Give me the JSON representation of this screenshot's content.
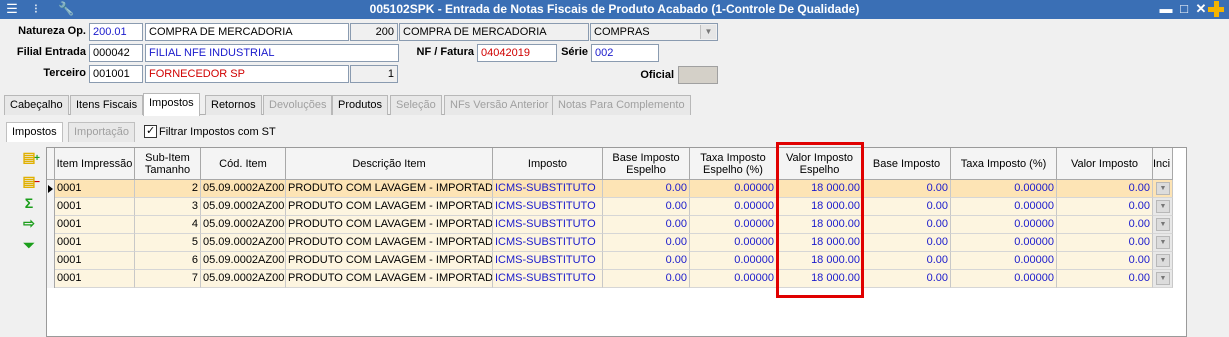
{
  "window": {
    "title": "005102SPK - Entrada de Notas Fiscais de Produto Acabado (1-Controle De Qualidade)",
    "min_label": "▬",
    "max_label": "□",
    "close_label": "✕"
  },
  "header": {
    "natureza_label": "Natureza Op.",
    "natureza_code": "200.01",
    "natureza_desc": "COMPRA DE MERCADORIA",
    "natureza_num": "200",
    "natureza_desc2": "COMPRA DE MERCADORIA",
    "natureza_combo": "COMPRAS",
    "filial_label": "Filial Entrada",
    "filial_code": "000042",
    "filial_desc": "FILIAL NFE INDUSTRIAL",
    "nf_label": "NF / Fatura",
    "nf_value": "04042019",
    "serie_label": "Série",
    "serie_value": "002",
    "terceiro_label": "Terceiro",
    "terceiro_code": "001001",
    "terceiro_desc": "FORNECEDOR SP",
    "terceiro_num": "1",
    "oficial_label": "Oficial",
    "oficial_value": ""
  },
  "tabs": [
    {
      "label": "Cabeçalho",
      "state": "normal"
    },
    {
      "label": "Itens Fiscais",
      "state": "normal"
    },
    {
      "label": "Impostos",
      "state": "active"
    },
    {
      "label": "Retornos",
      "state": "normal"
    },
    {
      "label": "Devoluções",
      "state": "disabled"
    },
    {
      "label": "Produtos",
      "state": "normal"
    },
    {
      "label": "Seleção",
      "state": "disabled"
    },
    {
      "label": "NFs Versão Anterior",
      "state": "disabled"
    },
    {
      "label": "Notas Para Complemento",
      "state": "disabled"
    }
  ],
  "subtabs": [
    {
      "label": "Impostos",
      "state": "active"
    },
    {
      "label": "Importação",
      "state": "disabled"
    }
  ],
  "filter_checkbox": {
    "label": "Filtrar Impostos com ST",
    "checked": true
  },
  "sidebar_icons": [
    "add-row-icon",
    "delete-row-icon",
    "sum-icon",
    "export-icon",
    "collapse-icon"
  ],
  "grid": {
    "columns": [
      "Item Impressão",
      "Sub-Item Tamanho",
      "Cód. Item",
      "Descrição Item",
      "Imposto",
      "Base Imposto Espelho",
      "Taxa Imposto Espelho (%)",
      "Valor Imposto Espelho",
      "Base Imposto",
      "Taxa Imposto (%)",
      "Valor Imposto",
      "Inci"
    ],
    "rows": [
      {
        "item": "0001",
        "sub": "2",
        "cod": "05.09.0002AZ00",
        "desc": "PRODUTO COM LAVAGEM - IMPORTADO",
        "imposto": "ICMS-SUBSTITUTO",
        "base_esp": "0.00",
        "taxa_esp": "0.00000",
        "valor_esp": "18 000.00",
        "base": "0.00",
        "taxa": "0.00000",
        "valor": "0.00"
      },
      {
        "item": "0001",
        "sub": "3",
        "cod": "05.09.0002AZ00",
        "desc": "PRODUTO COM LAVAGEM - IMPORTADO",
        "imposto": "ICMS-SUBSTITUTO",
        "base_esp": "0.00",
        "taxa_esp": "0.00000",
        "valor_esp": "18 000.00",
        "base": "0.00",
        "taxa": "0.00000",
        "valor": "0.00"
      },
      {
        "item": "0001",
        "sub": "4",
        "cod": "05.09.0002AZ00",
        "desc": "PRODUTO COM LAVAGEM - IMPORTADO",
        "imposto": "ICMS-SUBSTITUTO",
        "base_esp": "0.00",
        "taxa_esp": "0.00000",
        "valor_esp": "18 000.00",
        "base": "0.00",
        "taxa": "0.00000",
        "valor": "0.00"
      },
      {
        "item": "0001",
        "sub": "5",
        "cod": "05.09.0002AZ00",
        "desc": "PRODUTO COM LAVAGEM - IMPORTADO",
        "imposto": "ICMS-SUBSTITUTO",
        "base_esp": "0.00",
        "taxa_esp": "0.00000",
        "valor_esp": "18 000.00",
        "base": "0.00",
        "taxa": "0.00000",
        "valor": "0.00"
      },
      {
        "item": "0001",
        "sub": "6",
        "cod": "05.09.0002AZ00",
        "desc": "PRODUTO COM LAVAGEM - IMPORTADO",
        "imposto": "ICMS-SUBSTITUTO",
        "base_esp": "0.00",
        "taxa_esp": "0.00000",
        "valor_esp": "18 000.00",
        "base": "0.00",
        "taxa": "0.00000",
        "valor": "0.00"
      },
      {
        "item": "0001",
        "sub": "7",
        "cod": "05.09.0002AZ00",
        "desc": "PRODUTO COM LAVAGEM - IMPORTADO",
        "imposto": "ICMS-SUBSTITUTO",
        "base_esp": "0.00",
        "taxa_esp": "0.00000",
        "valor_esp": "18 000.00",
        "base": "0.00",
        "taxa": "0.00000",
        "valor": "0.00"
      }
    ]
  },
  "colors": {
    "titlebar": "#3a6fb5",
    "row_bg": "#fdf5e0",
    "selected_row_bg": "#fde4b5",
    "link_blue": "#1a1acc",
    "highlight_red": "#e00000"
  }
}
